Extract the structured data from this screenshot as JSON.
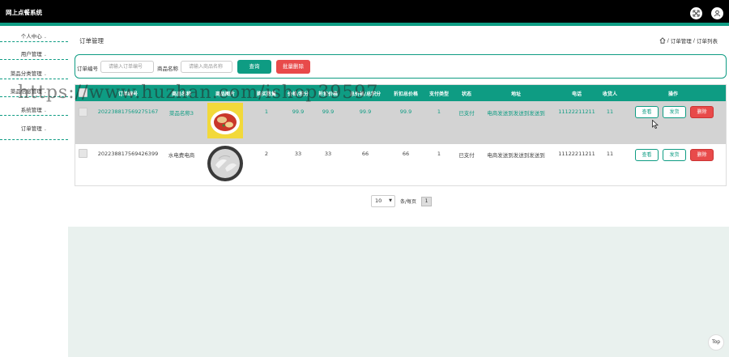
{
  "app": {
    "title": "网上点餐系统"
  },
  "header": {
    "icons": [
      "fullscreen-icon",
      "user-icon"
    ]
  },
  "sidebar": {
    "items": [
      {
        "label": "个人中心"
      },
      {
        "label": "用户管理"
      },
      {
        "label": "菜品分类管理"
      },
      {
        "label": "菜品信息管理"
      },
      {
        "label": "系统管理"
      },
      {
        "label": "订单管理"
      }
    ]
  },
  "page": {
    "title": "订单管理",
    "breadcrumb": [
      "订单管理",
      "订单列表"
    ],
    "breadcrumb_sep": "/"
  },
  "search": {
    "order_no_label": "订单编号",
    "order_no_placeholder": "请输入订单编号",
    "name_label": "商品名称",
    "name_placeholder": "请输入商品名称",
    "query_button": "查询",
    "batch_delete_button": "批量删除"
  },
  "table": {
    "columns": [
      "订单编号",
      "商品名称",
      "商品图片",
      "购买数量",
      "价格/积分",
      "折扣价格",
      "总价格/总积分",
      "折扣总价格",
      "支付类型",
      "状态",
      "地址",
      "电话",
      "收货人",
      "操作"
    ],
    "rows": [
      {
        "order_no": "202238817569275167",
        "name": "菜品名称3",
        "qty": "1",
        "price": "99.9",
        "discount": "99.9",
        "total": "99.9",
        "discount_total": "99.9",
        "pay_type": "1",
        "status": "已支付",
        "address": "电商发送到发送到发送到",
        "phone": "11122211211",
        "receiver": "11",
        "image": "dish-tomato"
      },
      {
        "order_no": "202238817569426399",
        "name": "水电费电商",
        "qty": "2",
        "price": "33",
        "discount": "33",
        "total": "66",
        "discount_total": "66",
        "pay_type": "1",
        "status": "已支付",
        "address": "电商发送到发送到发送到",
        "phone": "11122211211",
        "receiver": "11",
        "image": "dish-shrimp"
      }
    ],
    "actions": {
      "view": "查看",
      "ship": "发货",
      "delete": "删除"
    }
  },
  "pager": {
    "page_size": "10",
    "suffix": "条/每页",
    "current_page": "1"
  },
  "watermark": "https://www.huzhan.com/ishop39597",
  "top_button": "Top",
  "colors": {
    "accent": "#0e9c83",
    "danger": "#e84a4a",
    "topbar": "#000000"
  }
}
